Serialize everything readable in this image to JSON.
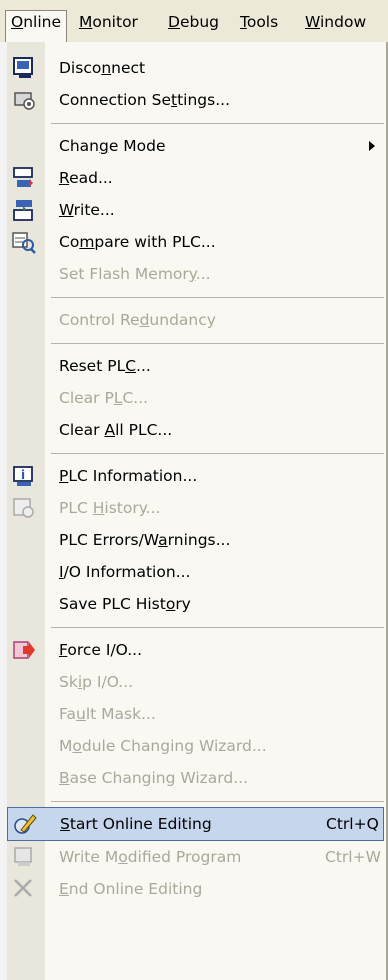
{
  "menubar": [
    {
      "pre": "",
      "u": "O",
      "post": "nline"
    },
    {
      "pre": "",
      "u": "M",
      "post": "onitor"
    },
    {
      "pre": "",
      "u": "D",
      "post": "ebug"
    },
    {
      "pre": "",
      "u": "T",
      "post": "ools"
    },
    {
      "pre": "",
      "u": "W",
      "post": "indow"
    }
  ],
  "menu": {
    "disconnect": {
      "pre": "Disco",
      "u": "n",
      "post": "nect"
    },
    "connection_settings": {
      "pre": "Connection Se",
      "u": "t",
      "post": "tings..."
    },
    "change_mode": {
      "pre": "Chan",
      "u": "g",
      "post": "e Mode"
    },
    "read": {
      "pre": "",
      "u": "R",
      "post": "ead..."
    },
    "write": {
      "pre": "",
      "u": "W",
      "post": "rite..."
    },
    "compare": {
      "pre": "Co",
      "u": "m",
      "post": "pare with PLC..."
    },
    "set_flash": {
      "pre": "Set Flash Memor",
      "u": "y",
      "post": "..."
    },
    "control_redundancy": {
      "pre": "Control Re",
      "u": "d",
      "post": "undancy"
    },
    "reset_plc": {
      "pre": "Reset PL",
      "u": "C",
      "post": "..."
    },
    "clear_plc": {
      "pre": "Clear P",
      "u": "L",
      "post": "C..."
    },
    "clear_all_plc": {
      "pre": "Clear ",
      "u": "A",
      "post": "ll PLC..."
    },
    "plc_information": {
      "pre": "",
      "u": "P",
      "post": "LC Information..."
    },
    "plc_history": {
      "pre": "PLC ",
      "u": "H",
      "post": "istory..."
    },
    "plc_errors": {
      "pre": "PLC Errors/W",
      "u": "a",
      "post": "rnings..."
    },
    "io_information": {
      "pre": "",
      "u": "I",
      "post": "/O Information..."
    },
    "save_plc_history": {
      "pre": "Save PLC Hist",
      "u": "o",
      "post": "ry"
    },
    "force_io": {
      "pre": "",
      "u": "F",
      "post": "orce I/O..."
    },
    "skip_io": {
      "pre": "Sk",
      "u": "i",
      "post": "p I/O..."
    },
    "fault_mask": {
      "pre": "Fa",
      "u": "u",
      "post": "lt Mask..."
    },
    "module_wizard": {
      "pre": "M",
      "u": "o",
      "post": "dule Changing Wizard..."
    },
    "base_wizard": {
      "pre": "",
      "u": "B",
      "post": "ase Changing Wizard..."
    },
    "start_online_editing": {
      "pre": "",
      "u": "S",
      "post": "tart Online Editing",
      "shortcut": "Ctrl+Q"
    },
    "write_modified": {
      "pre": "Write M",
      "u": "o",
      "post": "dified Program",
      "shortcut": "Ctrl+W"
    },
    "end_online_editing": {
      "pre": "",
      "u": "E",
      "post": "nd Online Editing"
    }
  },
  "colors": {
    "highlight": "#c6d6ec",
    "disabled": "#aca899",
    "menubar": "#ece9d8"
  }
}
